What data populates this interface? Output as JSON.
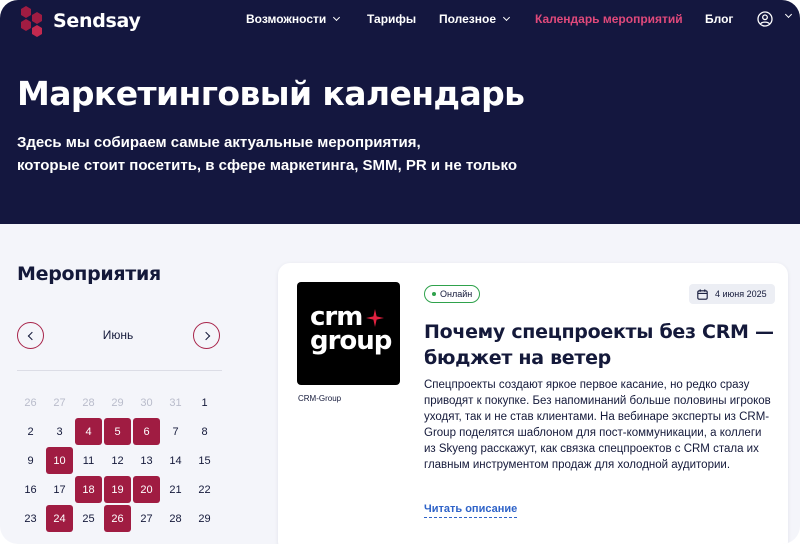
{
  "brand": {
    "name": "Sendsay",
    "accent": "#a01c42",
    "hero_bg": "#14173f",
    "active_nav": "#e0497b"
  },
  "nav": {
    "items": [
      {
        "label": "Возможности",
        "dropdown": true
      },
      {
        "label": "Тарифы",
        "dropdown": false
      },
      {
        "label": "Полезное",
        "dropdown": true
      },
      {
        "label": "Календарь мероприятий",
        "dropdown": false,
        "active": true
      },
      {
        "label": "Блог",
        "dropdown": false
      }
    ],
    "account_icon": "user-icon"
  },
  "hero": {
    "title": "Маркетинговый календарь",
    "subtitle_line1": "Здесь мы собираем самые актуальные мероприятия,",
    "subtitle_line2": "которые стоит посетить, в сфере маркетинга, SMM, PR и не только"
  },
  "events": {
    "title": "Мероприятия",
    "calendar": {
      "month": "Июнь",
      "weeks": [
        [
          {
            "d": "26",
            "m": true
          },
          {
            "d": "27",
            "m": true
          },
          {
            "d": "28",
            "m": true
          },
          {
            "d": "29",
            "m": true
          },
          {
            "d": "30",
            "m": true
          },
          {
            "d": "31",
            "m": true
          },
          {
            "d": "1"
          }
        ],
        [
          {
            "d": "2"
          },
          {
            "d": "3"
          },
          {
            "d": "4",
            "e": true
          },
          {
            "d": "5",
            "e": true
          },
          {
            "d": "6",
            "e": true
          },
          {
            "d": "7"
          },
          {
            "d": "8"
          }
        ],
        [
          {
            "d": "9"
          },
          {
            "d": "10",
            "e": true
          },
          {
            "d": "11"
          },
          {
            "d": "12"
          },
          {
            "d": "13"
          },
          {
            "d": "14"
          },
          {
            "d": "15"
          }
        ],
        [
          {
            "d": "16"
          },
          {
            "d": "17"
          },
          {
            "d": "18",
            "e": true
          },
          {
            "d": "19",
            "e": true
          },
          {
            "d": "20",
            "e": true
          },
          {
            "d": "21"
          },
          {
            "d": "22"
          }
        ],
        [
          {
            "d": "23"
          },
          {
            "d": "24",
            "e": true
          },
          {
            "d": "25"
          },
          {
            "d": "26",
            "e": true
          },
          {
            "d": "27"
          },
          {
            "d": "28"
          },
          {
            "d": "29"
          }
        ]
      ]
    },
    "card": {
      "logo_line1": "crm",
      "logo_line2": "group",
      "organizer": "CRM-Group",
      "format": "Онлайн",
      "date": "4 июня 2025",
      "title": "Почему спецпроекты без CRM — бюджет на ветер",
      "description": "Спецпроекты создают яркое первое касание, но редко сразу приводят к покупке. Без напоминаний больше половины игроков уходят, так и не став клиентами. На вебинаре эксперты из CRM-Group поделятся шаблоном для пост-коммуникации, а коллеги из Skyeng расскажут, как связка спецпроектов с CRM стала их главным инструментом продаж для холодной аудитории.",
      "read_more": "Читать описание"
    }
  }
}
